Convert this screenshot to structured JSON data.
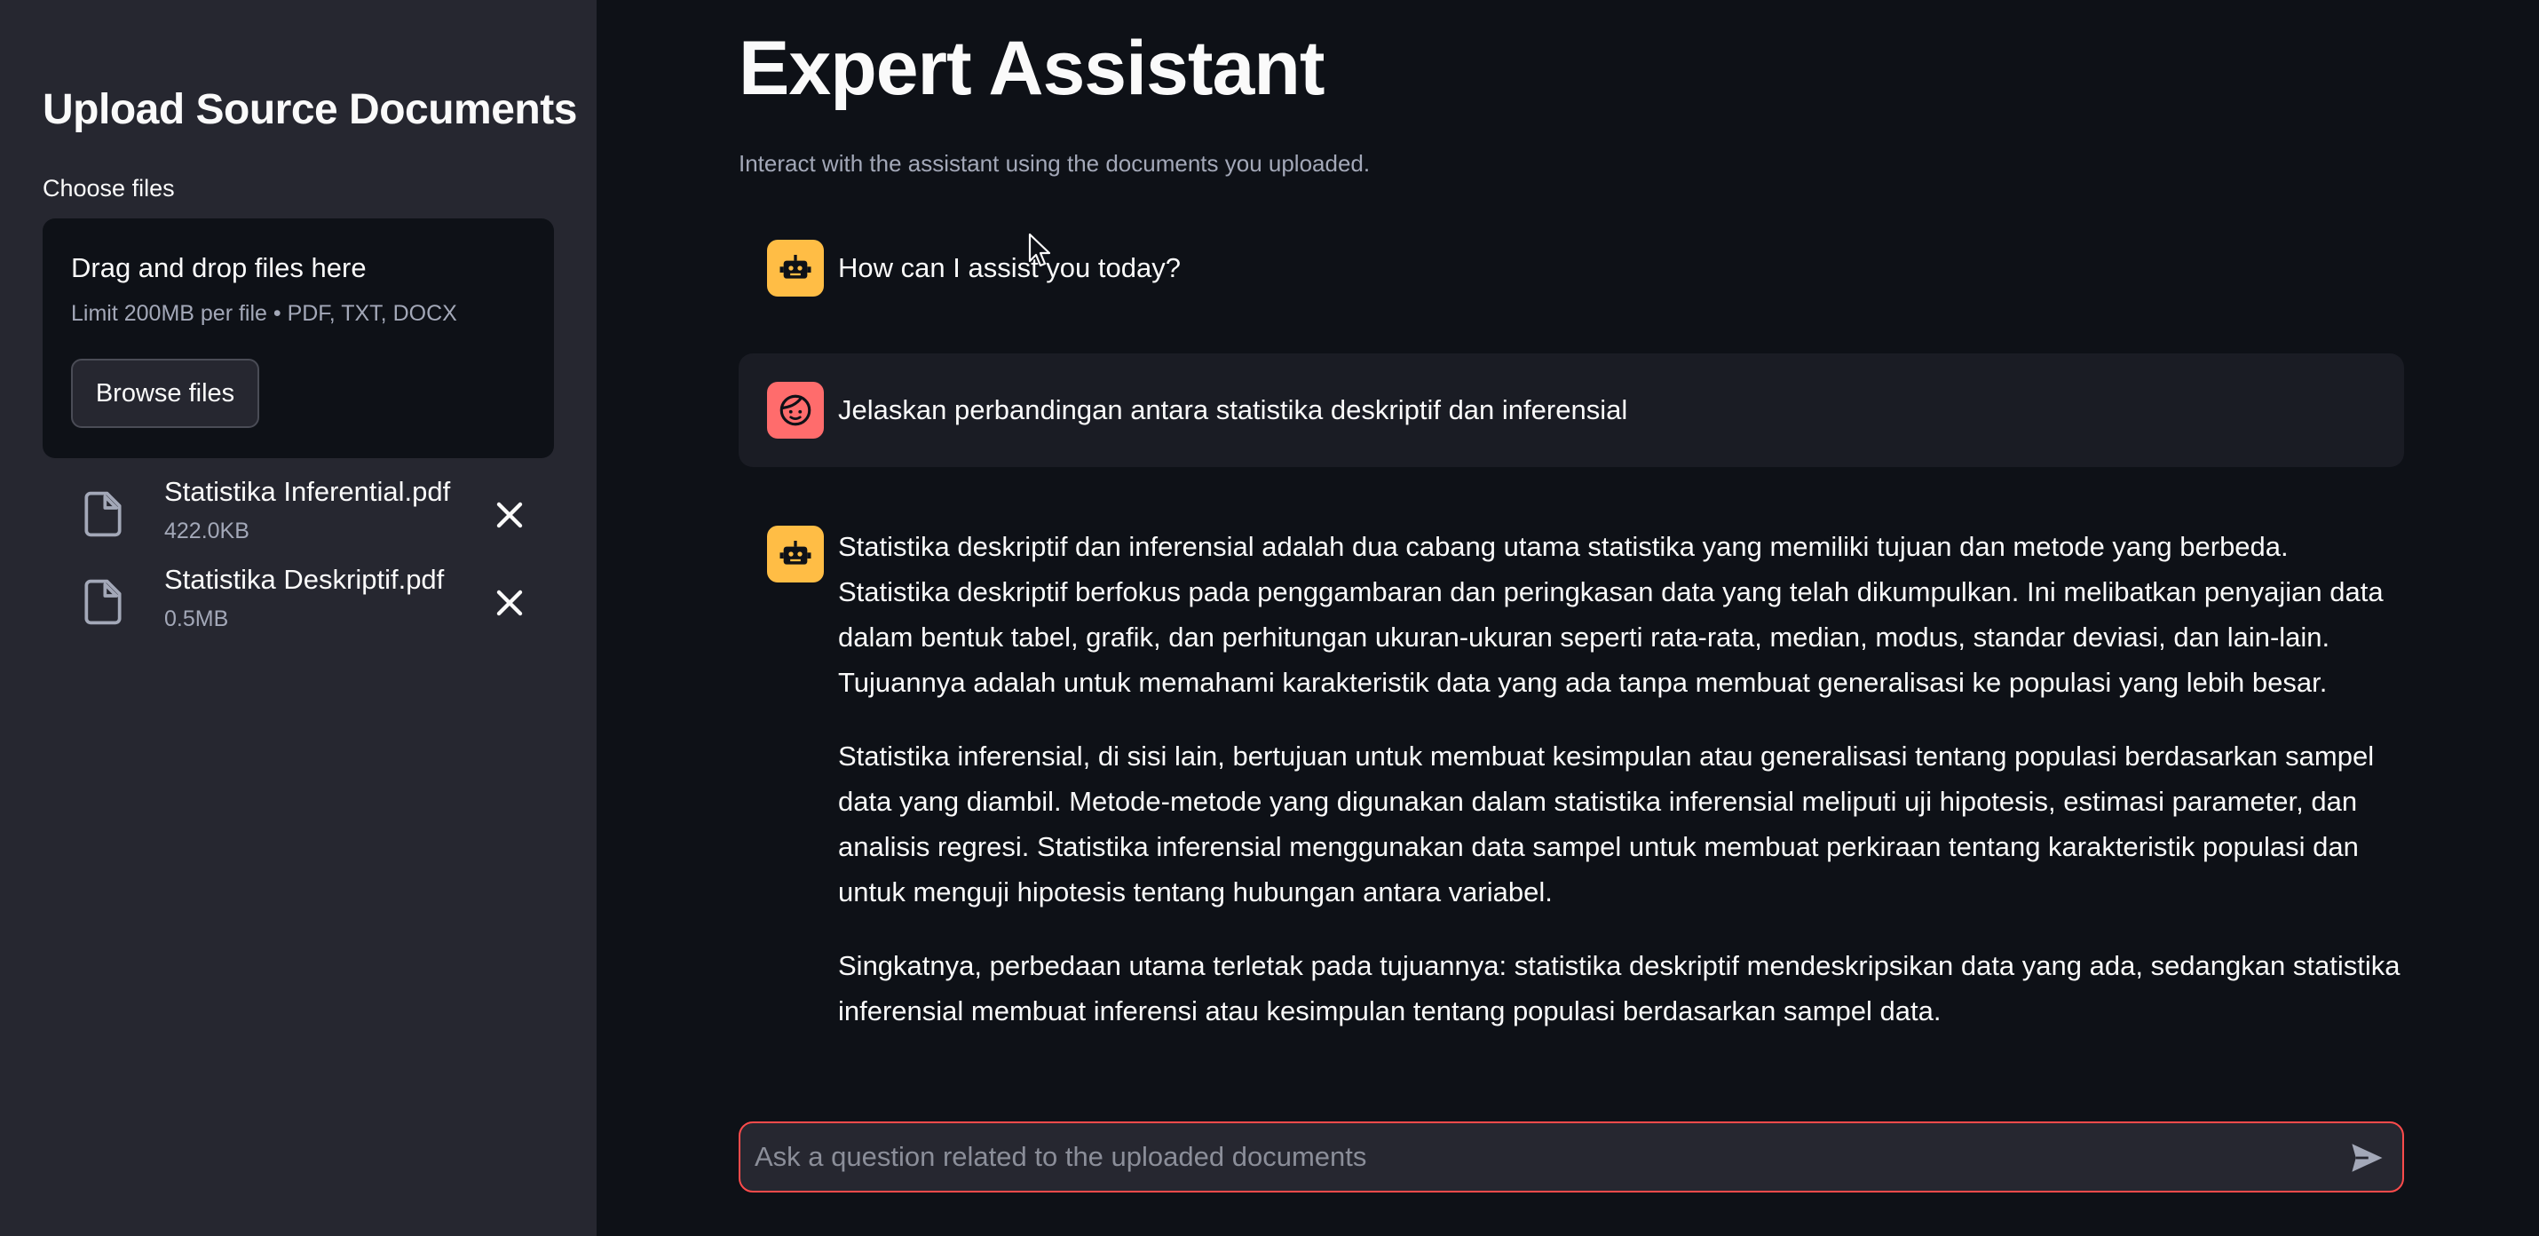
{
  "sidebar": {
    "title": "Upload Source Documents",
    "uploader": {
      "label": "Choose files",
      "drop_text": "Drag and drop files here",
      "limit_text": "Limit 200MB per file • PDF, TXT, DOCX",
      "browse_label": "Browse files"
    },
    "files": [
      {
        "name": "Statistika Inferential.pdf",
        "size": "422.0KB",
        "icon": "file-icon",
        "remove_icon": "close-icon"
      },
      {
        "name": "Statistika Deskriptif.pdf",
        "size": "0.5MB",
        "icon": "file-icon",
        "remove_icon": "close-icon"
      }
    ]
  },
  "main": {
    "title": "Expert Assistant",
    "caption": "Interact with the assistant using the documents you uploaded.",
    "messages": [
      {
        "role": "assistant",
        "avatar": "robot-icon",
        "paragraphs": [
          "How can I assist you today?"
        ]
      },
      {
        "role": "user",
        "avatar": "user-face-icon",
        "paragraphs": [
          "Jelaskan perbandingan antara statistika deskriptif dan inferensial"
        ]
      },
      {
        "role": "assistant",
        "avatar": "robot-icon",
        "paragraphs": [
          "Statistika deskriptif dan inferensial adalah dua cabang utama statistika yang memiliki tujuan dan metode yang berbeda. Statistika deskriptif berfokus pada penggambaran dan peringkasan data yang telah dikumpulkan. Ini melibatkan penyajian data dalam bentuk tabel, grafik, dan perhitungan ukuran-ukuran seperti rata-rata, median, modus, standar deviasi, dan lain-lain. Tujuannya adalah untuk memahami karakteristik data yang ada tanpa membuat generalisasi ke populasi yang lebih besar.",
          "Statistika inferensial, di sisi lain, bertujuan untuk membuat kesimpulan atau generalisasi tentang populasi berdasarkan sampel data yang diambil. Metode-metode yang digunakan dalam statistika inferensial meliputi uji hipotesis, estimasi parameter, dan analisis regresi. Statistika inferensial menggunakan data sampel untuk membuat perkiraan tentang karakteristik populasi dan untuk menguji hipotesis tentang hubungan antara variabel.",
          "Singkatnya, perbedaan utama terletak pada tujuannya: statistika deskriptif mendeskripsikan data yang ada, sedangkan statistika inferensial membuat inferensi atau kesimpulan tentang populasi berdasarkan sampel data."
        ]
      }
    ],
    "chat_input": {
      "placeholder": "Ask a question related to the uploaded documents",
      "value": "",
      "send_icon": "send-icon"
    }
  },
  "colors": {
    "sidebar_bg": "#262730",
    "main_bg": "#0e1117",
    "assistant_avatar": "#ffbd45",
    "user_avatar": "#ff6c6c",
    "input_border": "#ff4b4b"
  }
}
